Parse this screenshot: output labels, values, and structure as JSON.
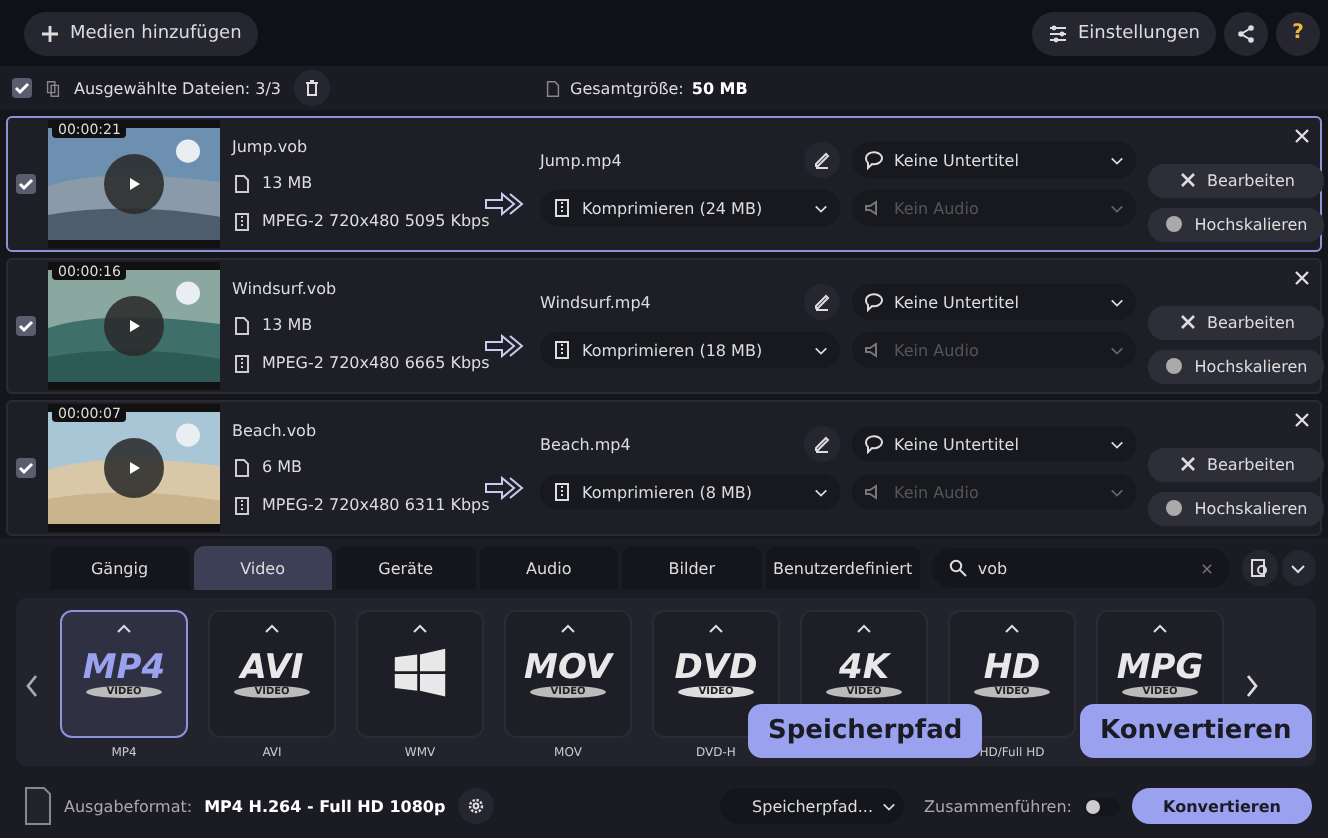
{
  "toolbar": {
    "add_button": "Medien hinzufügen",
    "settings_button": "Einstellungen",
    "help_button": "?"
  },
  "selection_bar": {
    "checked": true,
    "selected_files": "Ausgewählte Dateien: 3/3",
    "total_label": "Gesamtgröße:",
    "total_value": "50 MB"
  },
  "files": [
    {
      "selected": true,
      "checked": true,
      "duration": "00:00:21",
      "name": "Jump.vob",
      "size": "13 MB",
      "codec": "MPEG-2 720x480 5095 Kbps",
      "output": "Jump.mp4",
      "compression": "Komprimieren (24 MB)",
      "subtitle": "Keine Untertitel",
      "audio": "Kein Audio",
      "edit_button": "Bearbeiten",
      "upscale_button": "Hochskalieren"
    },
    {
      "selected": false,
      "checked": true,
      "duration": "00:00:16",
      "name": "Windsurf.vob",
      "size": "13 MB",
      "codec": "MPEG-2 720x480 6665 Kbps",
      "output": "Windsurf.mp4",
      "compression": "Komprimieren (18 MB)",
      "subtitle": "Keine Untertitel",
      "audio": "Kein Audio",
      "edit_button": "Bearbeiten",
      "upscale_button": "Hochskalieren"
    },
    {
      "selected": false,
      "checked": true,
      "duration": "00:00:07",
      "name": "Beach.vob",
      "size": "6 MB",
      "codec": "MPEG-2 720x480 6311 Kbps",
      "output": "Beach.mp4",
      "compression": "Komprimieren (8 MB)",
      "subtitle": "Keine Untertitel",
      "audio": "Kein Audio",
      "edit_button": "Bearbeiten",
      "upscale_button": "Hochskalieren"
    }
  ],
  "format_tabs": [
    {
      "label": "Gängig",
      "selected": false
    },
    {
      "label": "Video",
      "selected": true
    },
    {
      "label": "Geräte",
      "selected": false
    },
    {
      "label": "Audio",
      "selected": false
    },
    {
      "label": "Bilder",
      "selected": false
    },
    {
      "label": "Benutzerdefiniert",
      "selected": false
    }
  ],
  "search": {
    "value": "vob"
  },
  "formats": [
    {
      "kind": "text",
      "logo": "MP4",
      "sub": "VIDEO",
      "label": "MP4",
      "selected": true
    },
    {
      "kind": "text",
      "logo": "AVI",
      "sub": "VIDEO",
      "label": "AVI",
      "selected": false
    },
    {
      "kind": "windows",
      "label": "WMV",
      "selected": false
    },
    {
      "kind": "text",
      "logo": "MOV",
      "sub": "VIDEO",
      "label": "MOV",
      "selected": false
    },
    {
      "kind": "disc",
      "logo": "DVD",
      "sub": "VIDEO",
      "label": "DVD-H",
      "selected": false
    },
    {
      "kind": "text",
      "logo": "4K",
      "sub": "VIDEO",
      "selected": false
    },
    {
      "kind": "text",
      "logo": "HD",
      "sub": "VIDEO",
      "label": "HD/Full HD",
      "selected": false
    },
    {
      "kind": "text",
      "logo": "MPG",
      "sub": "VIDEO",
      "selected": false
    }
  ],
  "bottom_bar": {
    "output_label": "Ausgabeformat:",
    "output_value": "MP4 H.264 - Full HD 1080p",
    "save_path": "Speicherpfad...",
    "merge_label": "Zusammenführen:",
    "merge_on": false,
    "convert_button": "Konvertieren"
  },
  "callouts": [
    "Speicherpfad",
    "Konvertieren"
  ]
}
